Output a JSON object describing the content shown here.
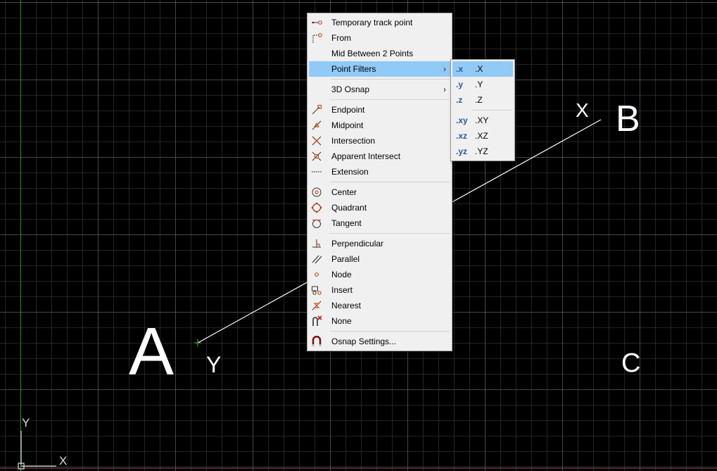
{
  "canvas": {
    "labels": {
      "a": "A",
      "b": "B",
      "c": "C",
      "x": "X",
      "y": "Y"
    },
    "ucs": {
      "x_label": "X",
      "y_label": "Y"
    }
  },
  "context_menu": {
    "items": [
      {
        "label": "Temporary track point",
        "icon": "temporary-track-point-icon"
      },
      {
        "label": "From",
        "icon": "from-icon"
      },
      {
        "label": "Mid Between 2 Points",
        "icon": ""
      },
      {
        "label": "Point Filters",
        "icon": "",
        "submenu": true,
        "highlighted": true
      },
      {
        "label": "3D Osnap",
        "icon": "",
        "submenu": true
      },
      {
        "label": "Endpoint",
        "icon": "endpoint-icon"
      },
      {
        "label": "Midpoint",
        "icon": "midpoint-icon"
      },
      {
        "label": "Intersection",
        "icon": "intersection-icon"
      },
      {
        "label": "Apparent Intersect",
        "icon": "apparent-intersect-icon"
      },
      {
        "label": "Extension",
        "icon": "extension-icon"
      },
      {
        "label": "Center",
        "icon": "center-icon"
      },
      {
        "label": "Quadrant",
        "icon": "quadrant-icon"
      },
      {
        "label": "Tangent",
        "icon": "tangent-icon"
      },
      {
        "label": "Perpendicular",
        "icon": "perpendicular-icon"
      },
      {
        "label": "Parallel",
        "icon": "parallel-icon"
      },
      {
        "label": "Node",
        "icon": "node-icon"
      },
      {
        "label": "Insert",
        "icon": "insert-icon"
      },
      {
        "label": "Nearest",
        "icon": "nearest-icon"
      },
      {
        "label": "None",
        "icon": "none-icon"
      },
      {
        "label": "Osnap Settings...",
        "icon": "osnap-settings-icon"
      }
    ],
    "submenu_arrow": "›"
  },
  "point_filters_submenu": {
    "items": [
      {
        "icon_text": ".x",
        "label": ".X",
        "highlighted": true
      },
      {
        "icon_text": ".y",
        "label": ".Y"
      },
      {
        "icon_text": ".z",
        "label": ".Z"
      },
      {
        "icon_text": ".xy",
        "label": ".XY"
      },
      {
        "icon_text": ".xz",
        "label": ".XZ"
      },
      {
        "icon_text": ".yz",
        "label": ".YZ"
      }
    ]
  },
  "colors": {
    "background": "#000000",
    "line": "#ffffff",
    "menu_background": "#f0f0f0",
    "menu_highlight": "#91c9f7",
    "icon_accent": "#c8501e",
    "ucs_y_axis": "#3a8a3a",
    "ucs_x_axis": "#8a2a2a"
  }
}
